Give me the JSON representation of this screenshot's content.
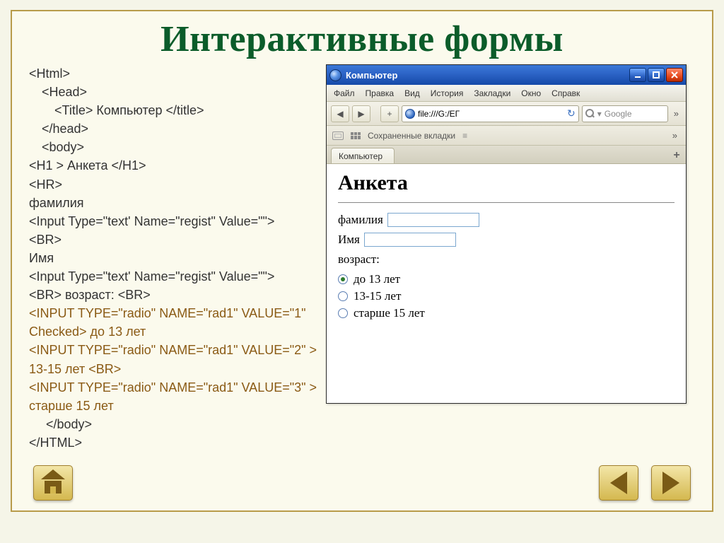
{
  "slide_title": "Интерактивные формы",
  "code": {
    "l1": "<Html>",
    "l2": "<Head>",
    "l3": "<Title> Компьютер </title>",
    "l4": "</head>",
    "l5": "<body>",
    "l6": "<H1 > Анкета </H1>",
    "l7": "<HR>",
    "l8": "фамилия",
    "l9": "<Input Type=\"text' Name=\"regist\" Value=\"\">",
    "l10": "<BR>",
    "l11": "Имя",
    "l12": "<Input Type=\"text' Name=\"regist\" Value=\"\">",
    "l13": "<BR> возраст: <BR>",
    "l14": "<INPUT TYPE=\"radio\" NAME=\"rad1\" VALUE=\"1\" Checked> до 13 лет",
    "l15": "<INPUT TYPE=\"radio\" NAME=\"rad1\" VALUE=\"2\" > 13-15 лет <BR>",
    "l16": "<INPUT TYPE=\"radio\" NAME=\"rad1\" VALUE=\"3\" > старше 15 лет",
    "l17": "</body>",
    "l18": "</HTML>"
  },
  "browser": {
    "window_title": "Компьютер",
    "menu": [
      "Файл",
      "Правка",
      "Вид",
      "История",
      "Закладки",
      "Окно",
      "Справк"
    ],
    "url": "file:///G:/ЕГ",
    "search_placeholder": "Google",
    "saved_tabs_label": "Сохраненные вкладки",
    "saved_tabs_mark": "≡",
    "tab_label": "Компьютер",
    "overflow": "»"
  },
  "page": {
    "heading": "Анкета",
    "surname_label": "фамилия",
    "name_label": "Имя",
    "age_label": "возраст:",
    "opt1": "до 13 лет",
    "opt2": "13-15 лет",
    "opt3": "старше 15 лет"
  }
}
